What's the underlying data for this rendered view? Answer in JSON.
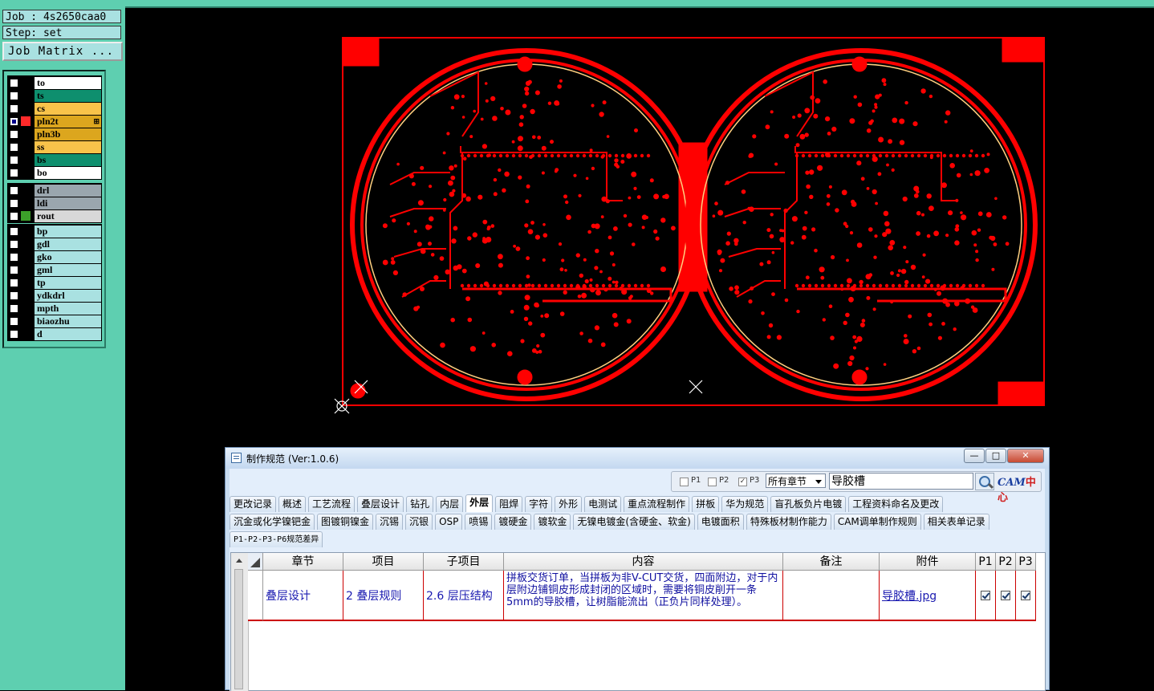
{
  "left_panel": {
    "job": "Job : 4s2650caa0",
    "step": "Step: set",
    "matrix_button": "Job Matrix ...",
    "groups": [
      {
        "layers": [
          {
            "name": "to",
            "color": "#ffffff",
            "swatch": "#000000",
            "selected": false
          },
          {
            "name": "ts",
            "color": "#0e8f6e",
            "swatch": "#000000",
            "selected": false
          },
          {
            "name": "cs",
            "color": "#f8c34a",
            "swatch": "#000000",
            "selected": false
          },
          {
            "name": "pln2t",
            "color": "#dca61e",
            "swatch": "#ff2a2a",
            "selected": true,
            "plus": "⊞"
          },
          {
            "name": "pln3b",
            "color": "#dca61e",
            "swatch": "#000000",
            "selected": false
          },
          {
            "name": "ss",
            "color": "#f8c34a",
            "swatch": "#000000",
            "selected": false
          },
          {
            "name": "bs",
            "color": "#0e8f6e",
            "swatch": "#000000",
            "selected": false
          },
          {
            "name": "bo",
            "color": "#ffffff",
            "swatch": "#000000",
            "selected": false
          }
        ]
      },
      {
        "layers": [
          {
            "name": "drl",
            "color": "#9aa6ae",
            "swatch": "#000000",
            "selected": false
          },
          {
            "name": "ldi",
            "color": "#9aa6ae",
            "swatch": "#000000",
            "selected": false
          },
          {
            "name": "rout",
            "color": "#d8d8d8",
            "swatch": "#3ca02a",
            "selected": false
          }
        ]
      },
      {
        "layers": [
          {
            "name": "bp",
            "color": "#a9e1e1",
            "swatch": "#000000",
            "selected": false
          },
          {
            "name": "gdl",
            "color": "#a9e1e1",
            "swatch": "#000000",
            "selected": false
          },
          {
            "name": "gko",
            "color": "#a9e1e1",
            "swatch": "#000000",
            "selected": false
          },
          {
            "name": "gml",
            "color": "#a9e1e1",
            "swatch": "#000000",
            "selected": false
          },
          {
            "name": "tp",
            "color": "#a9e1e1",
            "swatch": "#000000",
            "selected": false
          },
          {
            "name": "ydkdrl",
            "color": "#a9e1e1",
            "swatch": "#000000",
            "selected": false
          },
          {
            "name": "mpth",
            "color": "#a9e1e1",
            "swatch": "#000000",
            "selected": false
          },
          {
            "name": "biaozhu",
            "color": "#a9e1e1",
            "swatch": "#000000",
            "selected": false
          },
          {
            "name": "d",
            "color": "#a9e1e1",
            "swatch": "#000000",
            "selected": false
          }
        ]
      }
    ]
  },
  "canvas": {
    "background": "#000000",
    "copper_color": "#ff0000"
  },
  "dialog": {
    "title": "制作规范 (Ver:1.0.6)",
    "window_buttons": {
      "minimize": "—",
      "maximize": "□",
      "close": "✕"
    },
    "filters": [
      {
        "label": "P1",
        "checked": false
      },
      {
        "label": "P2",
        "checked": false
      },
      {
        "label": "P3",
        "checked": true
      }
    ],
    "chapter_select": "所有章节",
    "search_value": "导胶槽",
    "logo_text": "CAM",
    "logo_text2": "中心",
    "tab_rows": [
      [
        "更改记录",
        "概述",
        "工艺流程",
        "叠层设计",
        "钻孔",
        "内层",
        "外层",
        "阻焊",
        "字符",
        "外形",
        "电测试",
        "重点流程制作",
        "拼板",
        "华为规范",
        "盲孔板负片电镀",
        "工程资料命名及更改"
      ],
      [
        "沉金或化学镍钯金",
        "图镀铜镍金",
        "沉锡",
        "沉银",
        "OSP",
        "喷锡",
        "镀硬金",
        "镀软金",
        "无镍电镀金(含硬金、软金)",
        "电镀面积",
        "特殊板材制作能力",
        "CAM调单制作规则",
        "相关表单记录"
      ],
      [
        "P1-P2-P3-P6规范差异"
      ]
    ],
    "active_tab": "外层",
    "table": {
      "columns": [
        "章节",
        "项目",
        "子项目",
        "内容",
        "备注",
        "附件",
        "P1",
        "P2",
        "P3"
      ],
      "rows": [
        {
          "chapter": "叠层设计",
          "item": "2 叠层规则",
          "subitem": "2.6 层压结构",
          "content": "拼板交货订单，当拼板为非V-CUT交货，四面附边，对于内层附边铺铜皮形成封闭的区域时，需要将铜皮削开一条5mm的导胶槽，让树脂能流出（正负片同样处理）。",
          "note": "",
          "attachment": "导胶槽.jpg",
          "p1": true,
          "p2": true,
          "p3": true
        }
      ]
    }
  }
}
